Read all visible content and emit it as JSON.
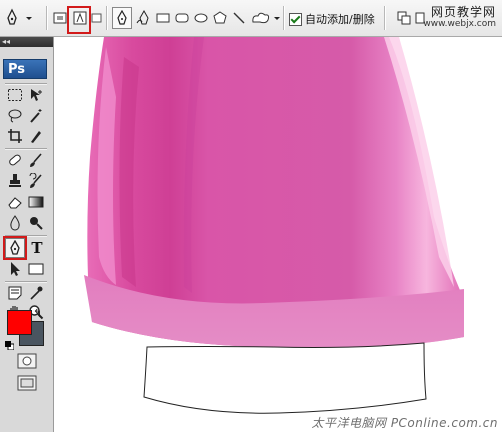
{
  "options_bar": {
    "auto_add_delete_label": "自动添加/删除",
    "auto_add_delete_checked": true
  },
  "watermark_top": {
    "line1": "网页教学网",
    "line2": "www.webjx.com"
  },
  "toolbox": {
    "collapse_glyph": "◂◂",
    "logo_text": "Ps",
    "active_tool": "pen-tool",
    "type_tool_label": "T",
    "swap_glyph": "↰",
    "foreground_color": "#ff0000",
    "background_color": "#4a5560"
  },
  "canvas": {
    "bottle_color": "#dc5fae",
    "highlight": "red-box",
    "watermark_bottom": "太平洋电脑网 PConline.com.cn"
  },
  "colors": {
    "highlight_red": "#d21a1a",
    "toolbox_bg": "#d9d9d9"
  }
}
